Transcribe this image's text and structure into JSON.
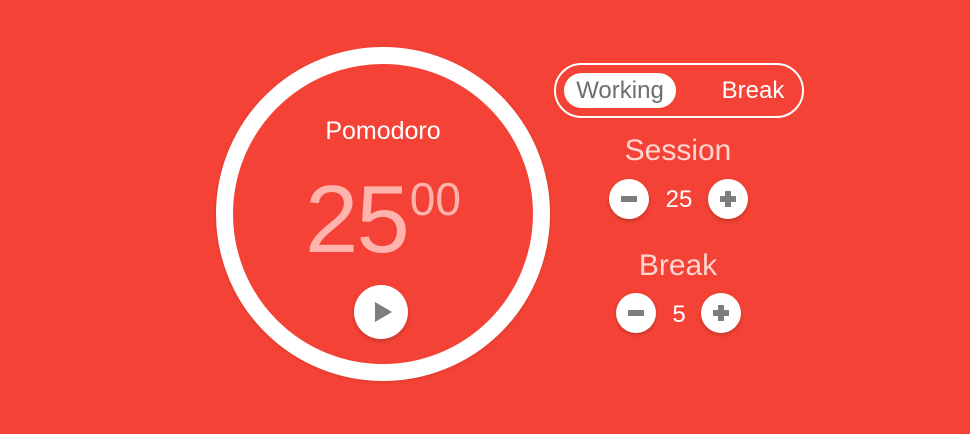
{
  "timer": {
    "title": "Pomodoro",
    "minutes": "25",
    "seconds": "00",
    "play_icon": "play-icon"
  },
  "mode_toggle": {
    "working_label": "Working",
    "break_label": "Break",
    "selected": "Working"
  },
  "session": {
    "label": "Session",
    "value": "25",
    "decrement_icon": "minus-icon",
    "increment_icon": "plus-icon"
  },
  "break_setting": {
    "label": "Break",
    "value": "5",
    "decrement_icon": "minus-icon",
    "increment_icon": "plus-icon"
  },
  "colors": {
    "background": "#f44336",
    "ring": "#ffffff",
    "time_text": "#ffb3ad",
    "icon_gray": "#7d7d7d"
  }
}
